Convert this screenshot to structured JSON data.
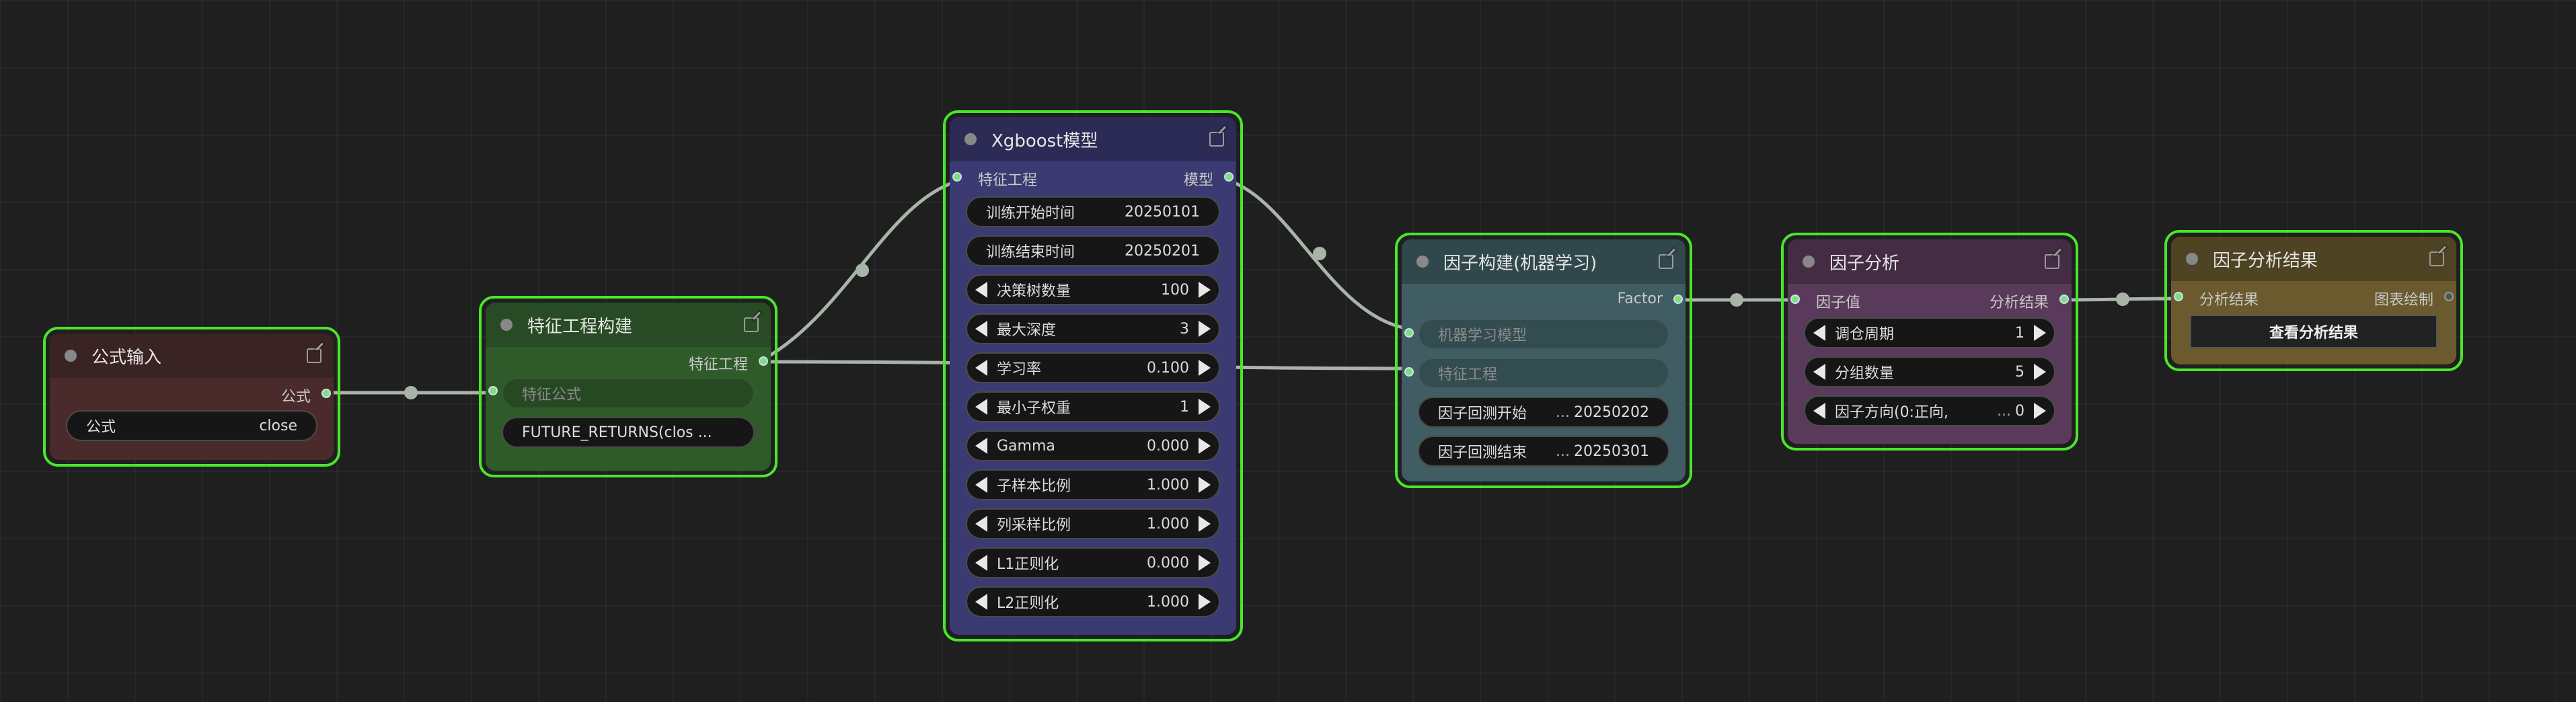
{
  "nodes": {
    "formula_input": {
      "title": "公式输入",
      "output": "公式",
      "widget_label": "公式",
      "widget_value": "close"
    },
    "feature_eng": {
      "title": "特征工程构建",
      "output": "特征工程",
      "input_ghost": "特征公式",
      "widget_value": "FUTURE_RETURNS(clos ..."
    },
    "xgboost": {
      "title": "Xgboost模型",
      "input": "特征工程",
      "output": "模型",
      "train_start": {
        "label": "训练开始时间",
        "value": "20250101"
      },
      "train_end": {
        "label": "训练结束时间",
        "value": "20250201"
      },
      "params": [
        {
          "label": "决策树数量",
          "value": "100"
        },
        {
          "label": "最大深度",
          "value": "3"
        },
        {
          "label": "学习率",
          "value": "0.100"
        },
        {
          "label": "最小子权重",
          "value": "1"
        },
        {
          "label": "Gamma",
          "value": "0.000"
        },
        {
          "label": "子样本比例",
          "value": "1.000"
        },
        {
          "label": "列采样比例",
          "value": "1.000"
        },
        {
          "label": "L1正则化",
          "value": "0.000"
        },
        {
          "label": "L2正则化",
          "value": "1.000"
        }
      ]
    },
    "factor_build": {
      "title": "因子构建(机器学习)",
      "output": "Factor",
      "input_model": "机器学习模型",
      "input_feature": "特征工程",
      "bt_start": {
        "label": "因子回测开始",
        "value": "20250202"
      },
      "bt_end": {
        "label": "因子回测结束",
        "value": "20250301"
      }
    },
    "factor_analysis": {
      "title": "因子分析",
      "input": "因子值",
      "output": "分析结果",
      "params": [
        {
          "label": "调仓周期",
          "value": "1"
        },
        {
          "label": "分组数量",
          "value": "5"
        },
        {
          "label": "因子方向(0:正向,",
          "value": "0"
        }
      ]
    },
    "analysis_result": {
      "title": "因子分析结果",
      "input": "分析结果",
      "output": "图表绘制",
      "button": "查看分析结果"
    }
  },
  "ellipsis": "...",
  "colors": {
    "selection_border": "#4ae62c",
    "link": "#a8b4a8",
    "port": "#7de07d"
  },
  "icons": [
    "node-status-dot",
    "edit-icon",
    "decrement-arrow-icon",
    "increment-arrow-icon"
  ]
}
